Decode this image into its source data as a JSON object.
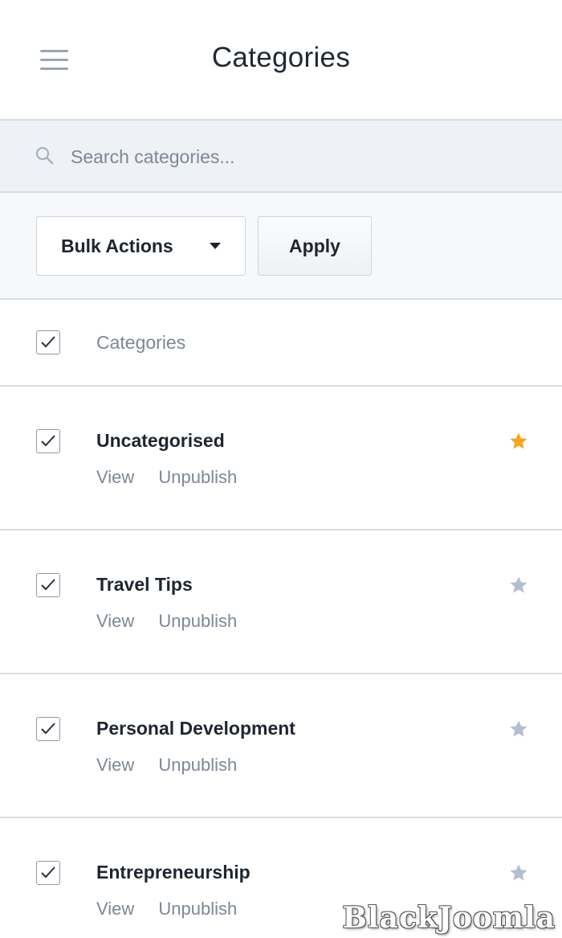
{
  "header": {
    "title": "Categories",
    "menu_icon": "hamburger-menu-icon"
  },
  "search": {
    "placeholder": "Search categories...",
    "value": "",
    "icon": "search-icon"
  },
  "toolbar": {
    "bulk_label": "Bulk Actions",
    "apply_label": "Apply"
  },
  "list": {
    "column_label": "Categories",
    "rows": [
      {
        "name": "Uncategorised",
        "action_view": "View",
        "action_unpublish": "Unpublish",
        "featured": true
      },
      {
        "name": "Travel Tips",
        "action_view": "View",
        "action_unpublish": "Unpublish",
        "featured": false
      },
      {
        "name": "Personal Development",
        "action_view": "View",
        "action_unpublish": "Unpublish",
        "featured": false
      },
      {
        "name": "Entrepreneurship",
        "action_view": "View",
        "action_unpublish": "Unpublish",
        "featured": false
      }
    ]
  },
  "colors": {
    "star_active": "#f5a623",
    "star_inactive": "#b4bfcc"
  },
  "watermark": "BlackJoomla"
}
